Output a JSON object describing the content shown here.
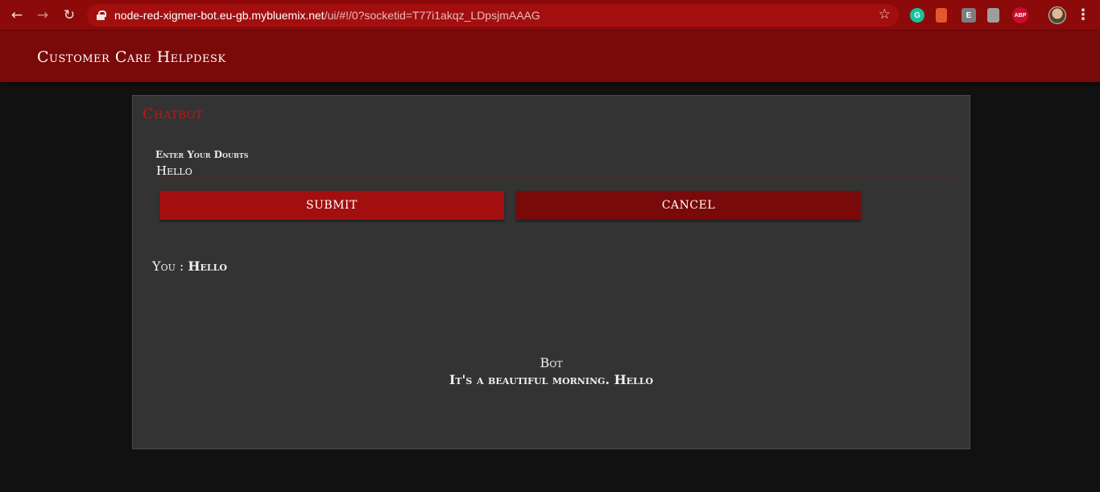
{
  "browser": {
    "url_host": "node-red-xigmer-bot.eu-gb.mybluemix.net",
    "url_path": "/ui/#!/0?socketid=T77i1akqz_LDpsjmAAAG",
    "back_icon": "arrow-left-icon",
    "forward_icon": "arrow-right-icon",
    "reload_icon": "reload-icon",
    "lock_icon": "lock-icon",
    "star_icon": "star-icon",
    "extensions": [
      "grammarly-icon",
      "bookmark-icon",
      "e-extension-icon",
      "document-icon",
      "adblock-icon"
    ],
    "abp_label": "ABP",
    "e_label": "E",
    "g_label": "G"
  },
  "header": {
    "title": "Customer Care Helpdesk"
  },
  "card": {
    "title": "Chatbot",
    "input_label": "Enter Your Doubts",
    "input_value": "Hello",
    "submit_label": "SUBMIT",
    "cancel_label": "CANCEL",
    "you_prefix": "You :",
    "you_message": "Hello",
    "bot_label": "Bot",
    "bot_message": "It's a beautiful morning. Hello"
  },
  "colors": {
    "browser_bar": "#8d0a0a",
    "header": "#7a0909",
    "submit": "#a30f0f",
    "cancel": "#7a0909",
    "card": "#333333",
    "card_title": "#c21414",
    "background": "#111111"
  }
}
